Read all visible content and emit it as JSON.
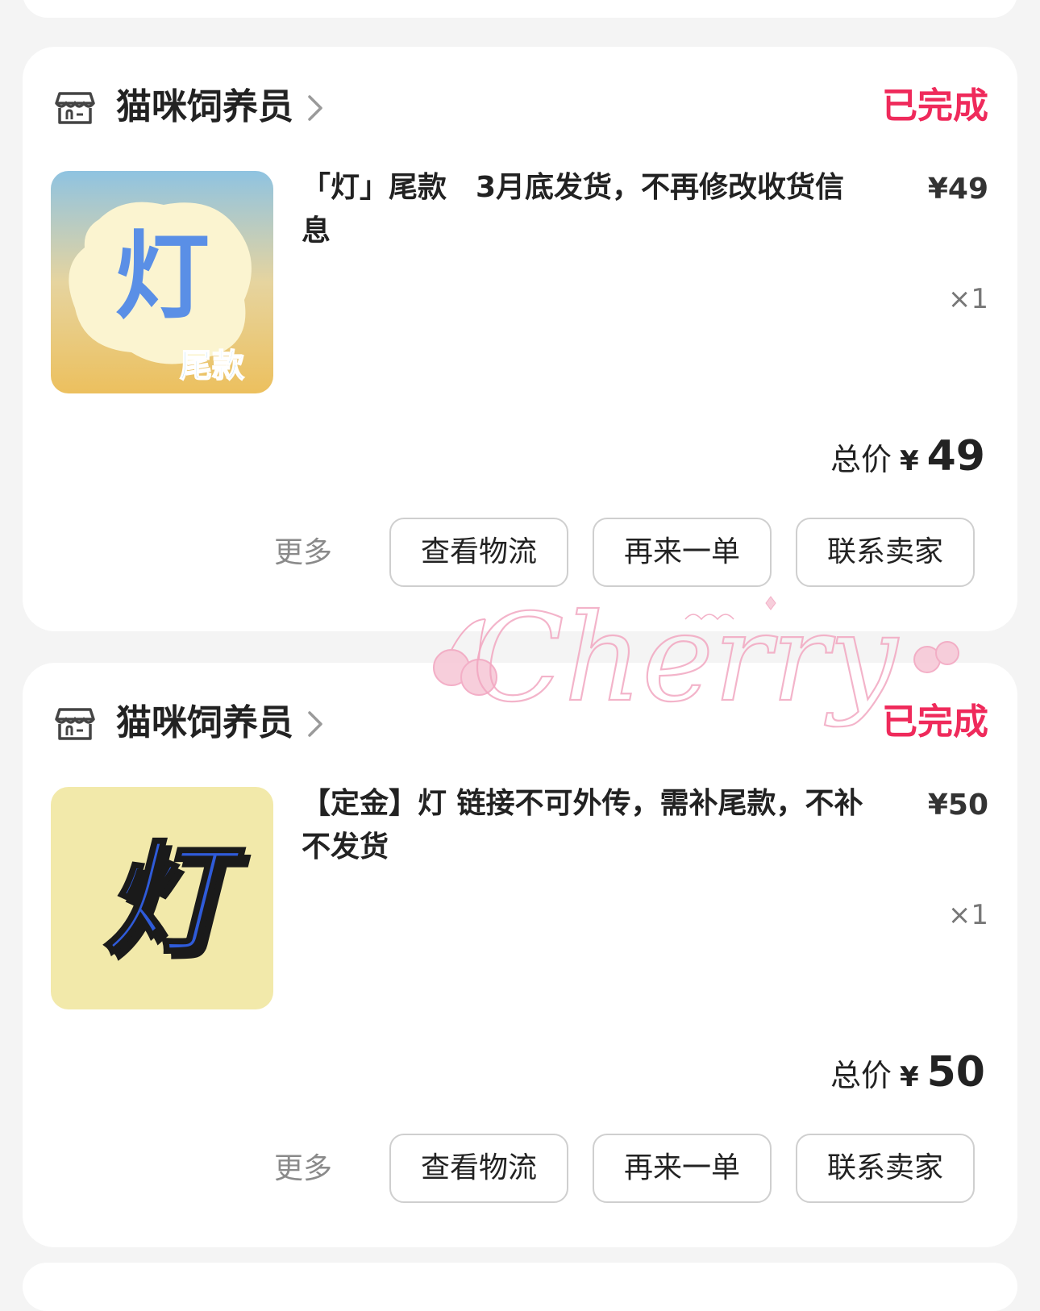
{
  "colors": {
    "background": "#f4f4f4",
    "card": "#ffffff",
    "status_red": "#ef2a5b",
    "button_border": "#cfcfcf",
    "muted_text": "#8a8a8a"
  },
  "orders": [
    {
      "shop": {
        "name": "猫咪饲养员",
        "icon": "shop-icon"
      },
      "status": "已完成",
      "item": {
        "thumbnail": {
          "text": "灯",
          "subtext": "尾款"
        },
        "title": "「灯」尾款　3月底发货，不再修改收货信息",
        "unit_price": "¥49",
        "quantity": "×1"
      },
      "total": {
        "label": "总价",
        "currency": "¥",
        "value": "49"
      },
      "actions": {
        "more": "更多",
        "logistics": "查看物流",
        "reorder": "再来一单",
        "contact": "联系卖家"
      }
    },
    {
      "shop": {
        "name": "猫咪饲养员",
        "icon": "shop-icon"
      },
      "status": "已完成",
      "item": {
        "thumbnail": {
          "text": "灯"
        },
        "title": "【定金】灯 链接不可外传，需补尾款，不补不发货",
        "unit_price": "¥50",
        "quantity": "×1"
      },
      "total": {
        "label": "总价",
        "currency": "¥",
        "value": "50"
      },
      "actions": {
        "more": "更多",
        "logistics": "查看物流",
        "reorder": "再来一单",
        "contact": "联系卖家"
      }
    }
  ],
  "watermark": {
    "text": "Cherry"
  }
}
